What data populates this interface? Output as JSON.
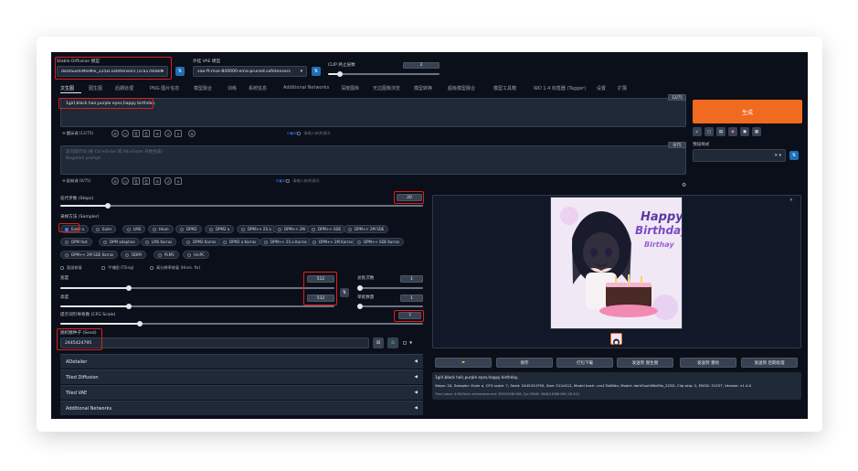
{
  "top": {
    "checkpoint_label": "Stable Diffusion 模型",
    "checkpoint_value": "darkSushiMixMix_225D.safetensors [cca17b08d",
    "vae_label": "外挂 VAE 模型",
    "vae_value": "vae-ft-mse-840000-ema-pruned.safetensors",
    "clip_label": "CLIP 终止层数",
    "clip_value": "2"
  },
  "tabs": [
    "文生图",
    "图生图",
    "后期处理",
    "PNG 图片信息",
    "模型融合",
    "训练",
    "系统信息",
    "Additional Networks",
    "深度图库",
    "无边图像浏览",
    "模型转换",
    "超级模型融合",
    "模型工具箱",
    "WD 1.4 标签器 (Tagger)",
    "设置",
    "扩展"
  ],
  "prompt": {
    "text": "1girl,black hair,purple eyes,happy birthday,",
    "counter": "12/75",
    "neg_placeholder_1": "反向提示词 (按 Ctrl+Enter 或 Alt+Enter 开始生成)",
    "neg_placeholder_2": "Negative prompt",
    "neg_counter": "0/75",
    "pos_section_label": "提示词",
    "pos_section_count": "(12/75)",
    "neg_section_label": "反向词",
    "neg_section_count": "(0/75)",
    "tag_input_placeholder": "请输入新关键词"
  },
  "generate_label": "生成",
  "style_label": "预设样式",
  "steps": {
    "label": "迭代步数 (Steps)",
    "value": "20",
    "fraction": 0.13
  },
  "sampler": {
    "label": "采样方法 (Sampler)",
    "selected": "Euler a",
    "rows": [
      [
        "Euler a",
        "Euler",
        "LMS",
        "Heun",
        "DPM2",
        "DPM2 a",
        "DPM++ 2S a",
        "DPM++ 2M",
        "DPM++ SDE",
        "DPM++ 2M SDE"
      ],
      [
        "DPM fast",
        "DPM adaptive",
        "LMS Karras",
        "DPM2 Karras",
        "DPM2 a Karras",
        "DPM++ 2S a Karras",
        "DPM++ 2M Karras",
        "DPM++ SDE Karras"
      ],
      [
        "DPM++ 2M SDE Karras",
        "DDIM",
        "PLMS",
        "UniPC"
      ]
    ]
  },
  "checks": [
    "面部修复",
    "平铺图 (Tiling)",
    "高分辨率修复 (Hires. fix)"
  ],
  "width": {
    "label": "宽度",
    "value": "512",
    "fraction": 0.25
  },
  "height": {
    "label": "高度",
    "value": "512",
    "fraction": 0.25
  },
  "batch_count": {
    "label": "总批次数",
    "value": "1",
    "fraction": 0.0
  },
  "batch_size": {
    "label": "单批数量",
    "value": "1",
    "fraction": 0.0
  },
  "cfg": {
    "label": "提示词引导系数 (CFG Scale)",
    "value": "7",
    "fraction": 0.22
  },
  "seed": {
    "label": "随机数种子 (Seed)",
    "value": "2445424795"
  },
  "accordions": [
    "ADetailer",
    "Tiled Diffusion",
    "Tiled VAE",
    "Additional Networks"
  ],
  "output": {
    "image_text_1": "Happy",
    "image_text_2": "Birthday",
    "image_text_3": "Birthay",
    "buttons": [
      "保存",
      "打包下载",
      "发送到 图生图",
      "发送到 重绘",
      "发送到 后期处理"
    ],
    "info_prompt": "1girl,black hair,purple eyes,happy birthday,",
    "info_params": "Steps: 20, Sampler: Euler a, CFG scale: 7, Seed: 2445424795, Size: 512x512, Model hash: cca17b08da, Model: darkSushiMixMix_225D, Clip skip: 2, ENSD: 31337, Version: v1.4.0",
    "info_time": "Time taken: 4.65sTorch active/reserved: 3559/4336 MiB, Sys VRAM: 4648/16368 MiB (28.4%)"
  },
  "colors": {
    "accent": "#f06a1f",
    "bg": "#0b0f19",
    "panel": "#1f2937",
    "highlight": "#e11d1d"
  }
}
